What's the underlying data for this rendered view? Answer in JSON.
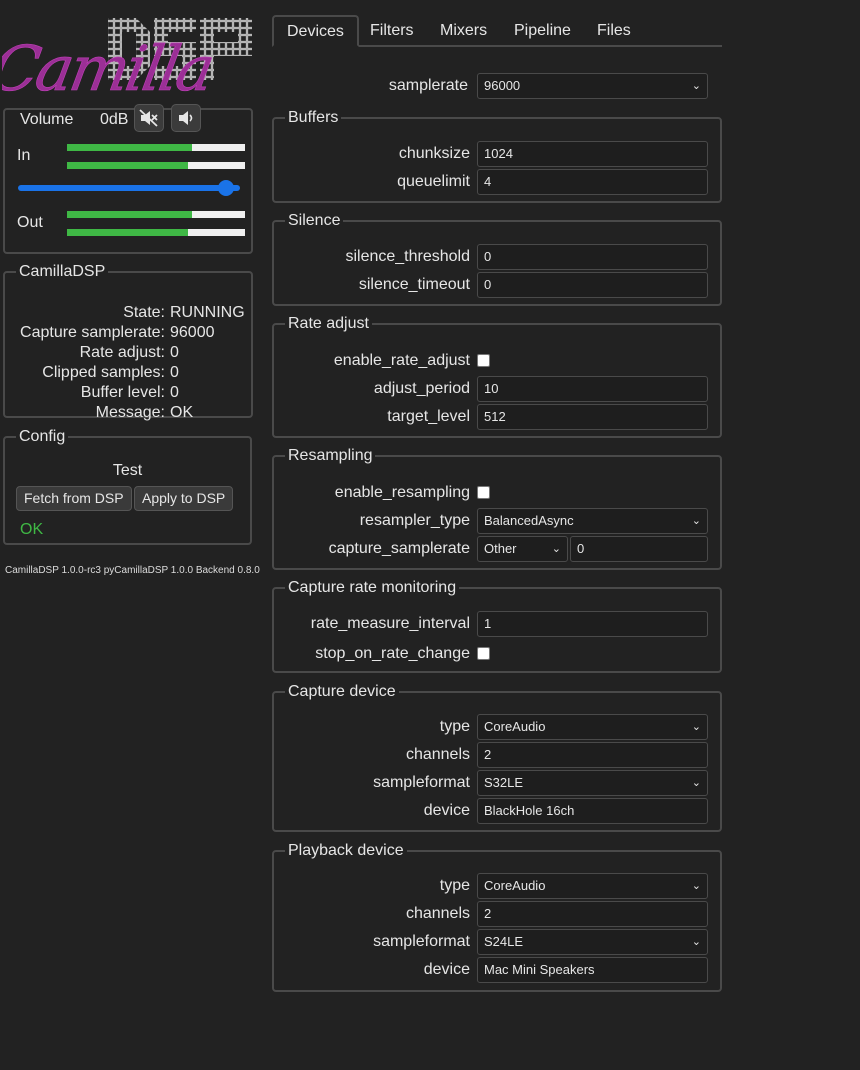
{
  "logo": {
    "text_back": "DSP",
    "text_front": "Camilla"
  },
  "volume": {
    "title": "Volume",
    "db": "0dB",
    "in_label": "In",
    "out_label": "Out",
    "in_levels": [
      0.7,
      0.68
    ],
    "out_levels": [
      0.7,
      0.68
    ],
    "slider_level": 0.97
  },
  "status": {
    "title": "CamillaDSP",
    "rows": [
      {
        "k": "State:",
        "v": "RUNNING"
      },
      {
        "k": "Capture samplerate:",
        "v": "96000"
      },
      {
        "k": "Rate adjust:",
        "v": "0"
      },
      {
        "k": "Clipped samples:",
        "v": "0"
      },
      {
        "k": "Buffer level:",
        "v": "0"
      },
      {
        "k": "Message:",
        "v": "OK"
      }
    ]
  },
  "config": {
    "title": "Config",
    "name": "Test",
    "fetch_label": "Fetch from DSP",
    "apply_label": "Apply to DSP",
    "status": "OK"
  },
  "version": "CamillaDSP 1.0.0-rc3 pyCamillaDSP 1.0.0 Backend 0.8.0",
  "tabs": [
    "Devices",
    "Filters",
    "Mixers",
    "Pipeline",
    "Files"
  ],
  "form": {
    "samplerate": {
      "label": "samplerate",
      "value": "96000"
    },
    "buffers": {
      "title": "Buffers",
      "chunksize": {
        "label": "chunksize",
        "value": "1024"
      },
      "queuelimit": {
        "label": "queuelimit",
        "value": "4"
      }
    },
    "silence": {
      "title": "Silence",
      "threshold": {
        "label": "silence_threshold",
        "value": "0"
      },
      "timeout": {
        "label": "silence_timeout",
        "value": "0"
      }
    },
    "rate_adjust": {
      "title": "Rate adjust",
      "enable": {
        "label": "enable_rate_adjust"
      },
      "period": {
        "label": "adjust_period",
        "value": "10"
      },
      "target": {
        "label": "target_level",
        "value": "512"
      }
    },
    "resampling": {
      "title": "Resampling",
      "enable": {
        "label": "enable_resampling"
      },
      "type": {
        "label": "resampler_type",
        "value": "BalancedAsync"
      },
      "capture_sr": {
        "label": "capture_samplerate",
        "select": "Other",
        "value": "0"
      }
    },
    "monitoring": {
      "title": "Capture rate monitoring",
      "interval": {
        "label": "rate_measure_interval",
        "value": "1"
      },
      "stop": {
        "label": "stop_on_rate_change"
      }
    },
    "capture": {
      "title": "Capture device",
      "type": {
        "label": "type",
        "value": "CoreAudio"
      },
      "channels": {
        "label": "channels",
        "value": "2"
      },
      "format": {
        "label": "sampleformat",
        "value": "S32LE"
      },
      "device": {
        "label": "device",
        "value": "BlackHole 16ch"
      }
    },
    "playback": {
      "title": "Playback device",
      "type": {
        "label": "type",
        "value": "CoreAudio"
      },
      "channels": {
        "label": "channels",
        "value": "2"
      },
      "format": {
        "label": "sampleformat",
        "value": "S24LE"
      },
      "device": {
        "label": "device",
        "value": "Mac Mini Speakers"
      }
    }
  },
  "colors": {
    "background": "#222222",
    "meter": "#3fb845",
    "slider": "#1a73e8",
    "ok": "#3fb845"
  }
}
